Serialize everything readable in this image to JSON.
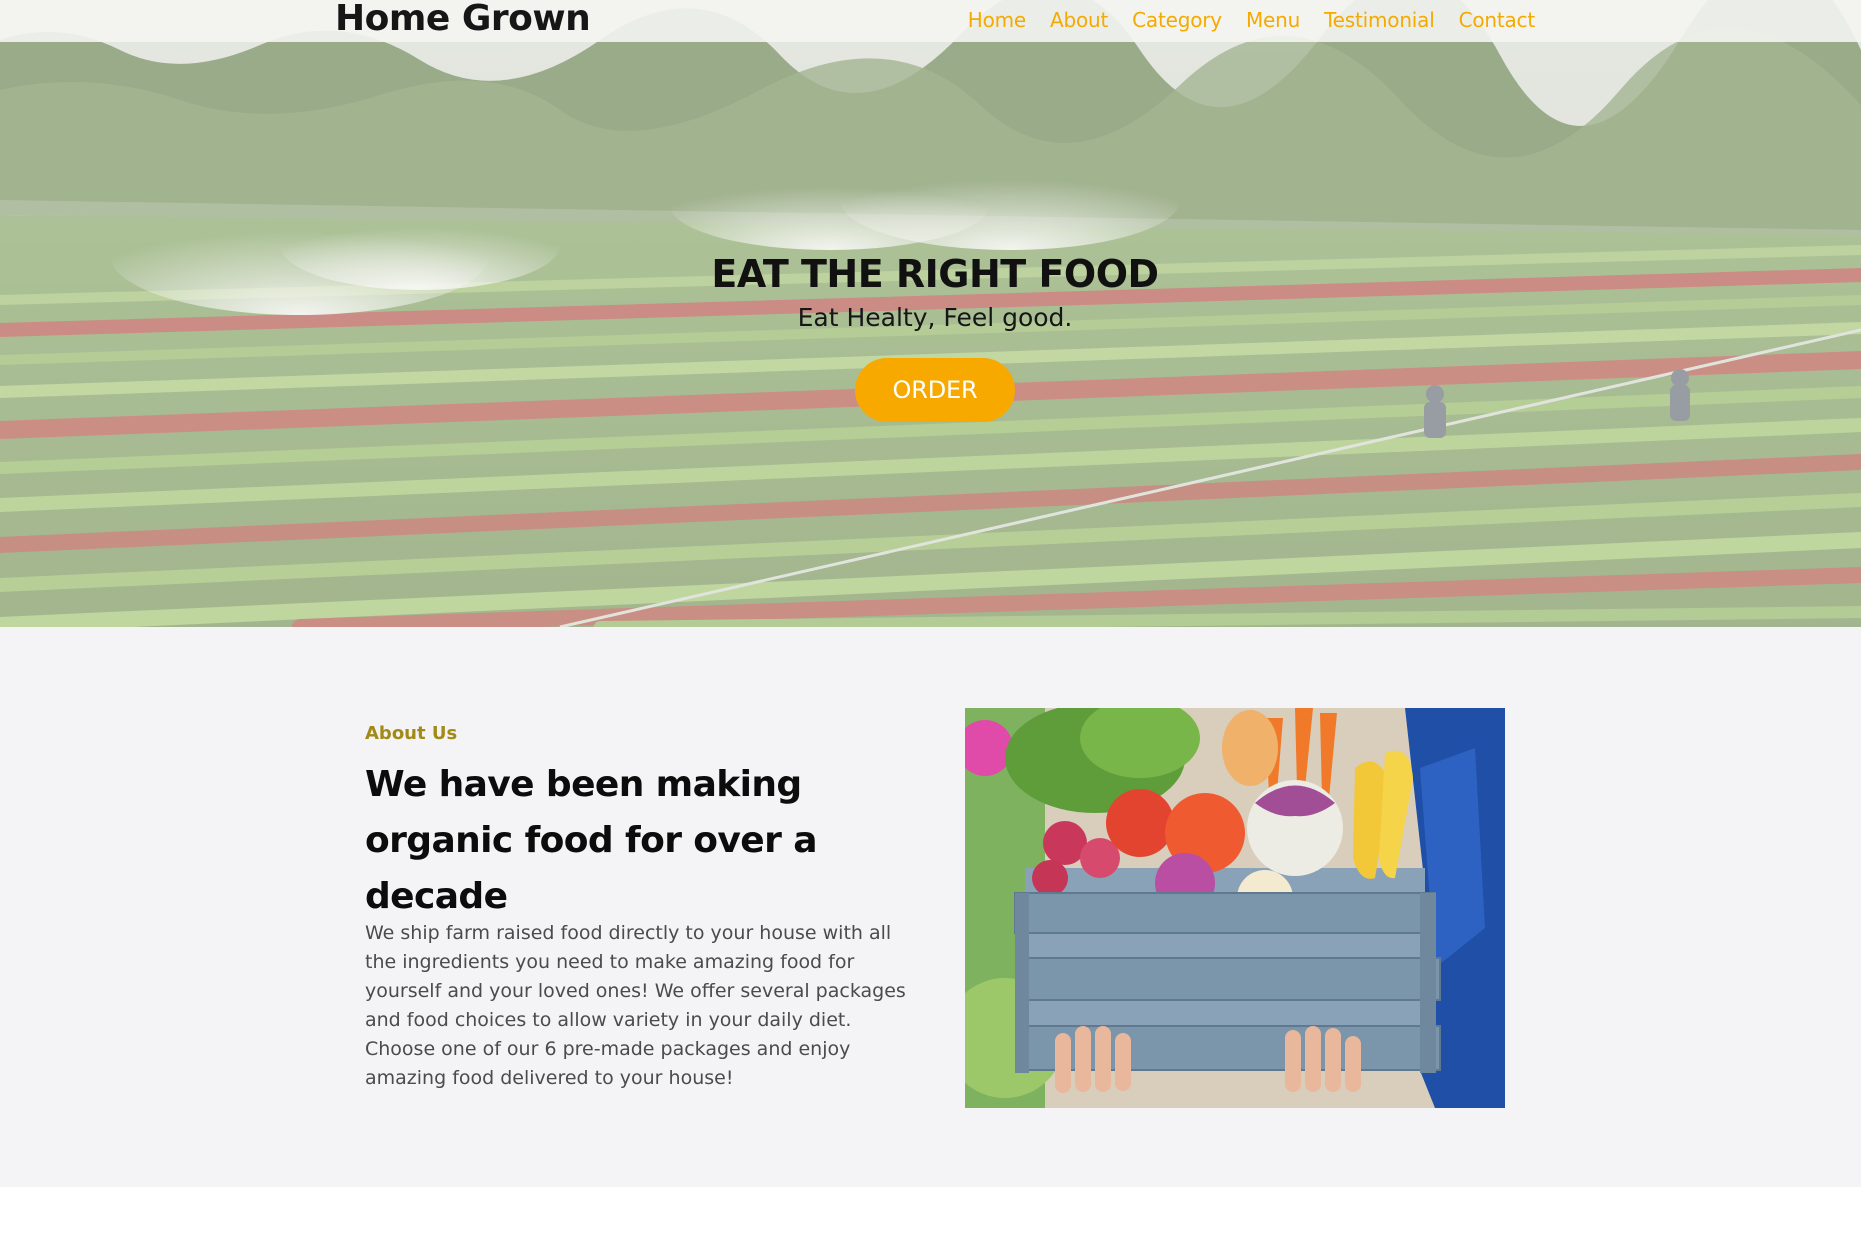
{
  "nav": {
    "brand": "Home Grown",
    "links": [
      "Home",
      "About",
      "Category",
      "Menu",
      "Testimonial",
      "Contact"
    ]
  },
  "hero": {
    "title": "EAT THE RIGHT FOOD",
    "subtitle": "Eat Healty, Feel good.",
    "button": "ORDER"
  },
  "about": {
    "eyebrow": "About Us",
    "heading": "We have been making organic food for over a decade",
    "text": "We ship farm raised food directly to your house with all the ingredients you need to make amazing food for yourself and your loved ones! We offer several packages and food choices to allow variety in your daily diet. Choose one of our 6 pre-made packages and enjoy amazing food delivered to your house!"
  },
  "colors": {
    "accent": "#f7a900",
    "nav_link": "#f4aa00",
    "eyebrow": "#a28a16",
    "section_bg": "#f4f4f6"
  }
}
